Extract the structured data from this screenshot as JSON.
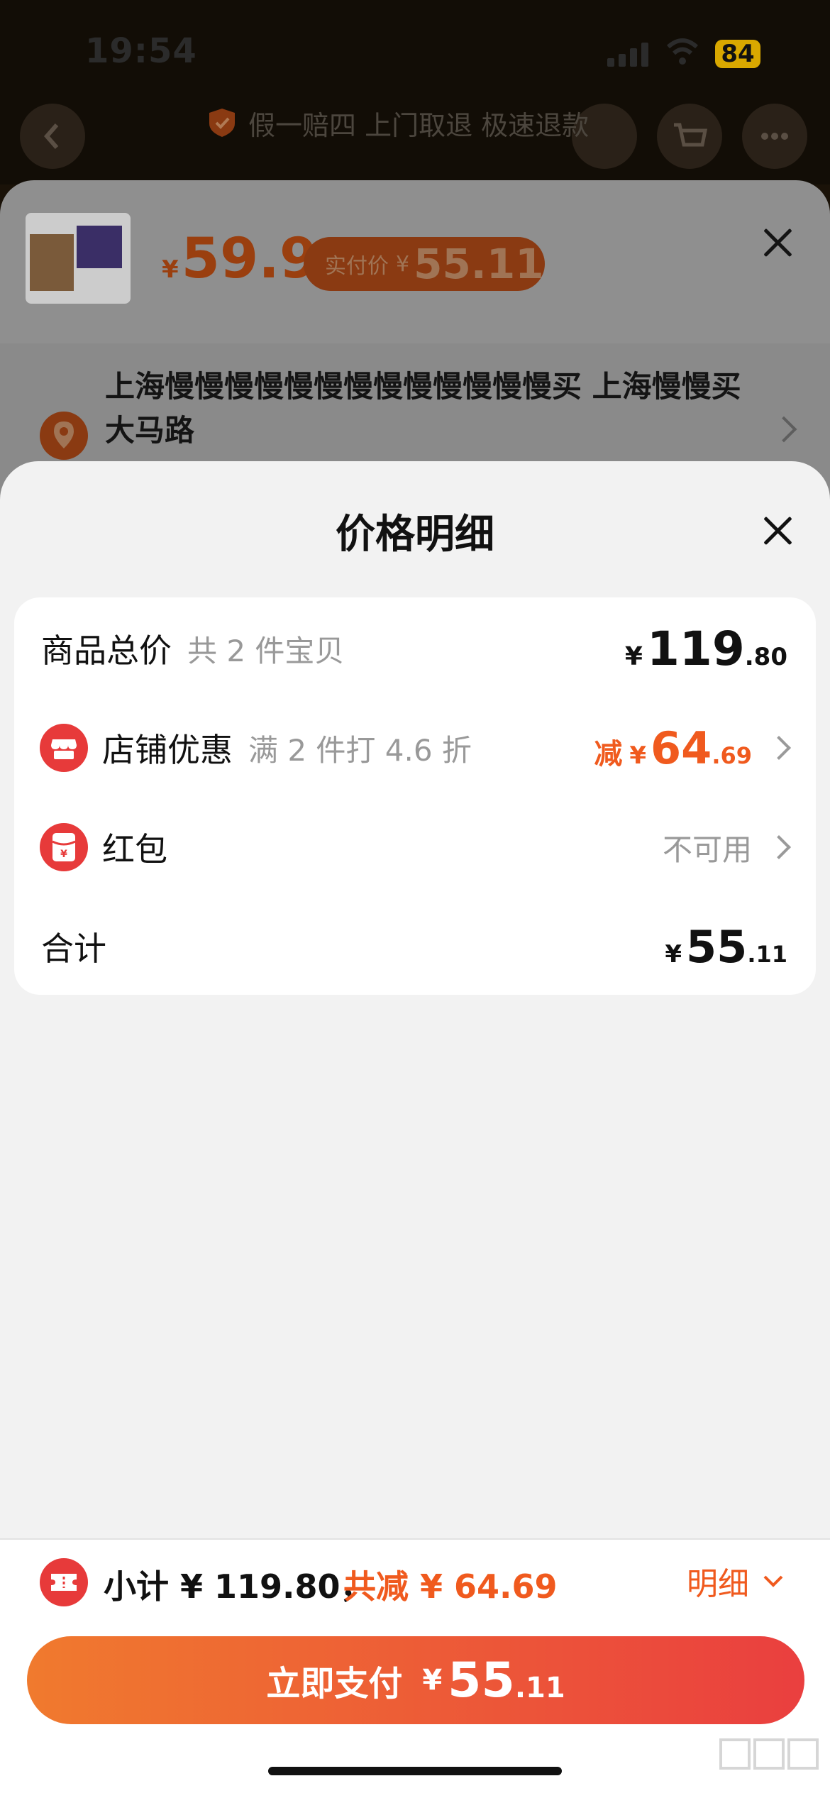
{
  "status_bar": {
    "time": "19:54",
    "battery": "84"
  },
  "nav": {
    "guarantee": "假一赔四 上门取退 极速退款"
  },
  "product_sheet": {
    "currency": "¥",
    "price": "59.9",
    "pay_label": "实付价",
    "pay_amount": "55.11",
    "address": "上海慢慢慢慢慢慢慢慢慢慢慢慢慢买 上海慢慢买大马路"
  },
  "detail": {
    "title": "价格明细",
    "rows": {
      "total": {
        "label": "商品总价",
        "sub": "共 2 件宝贝",
        "currency": "¥",
        "int": "119",
        "dec": ".80"
      },
      "shop": {
        "label": "店铺优惠",
        "sub": "满 2 件打 4.6 折",
        "prefix": "减",
        "currency": "¥",
        "int": "64",
        "dec": ".69"
      },
      "redpacket": {
        "label": "红包",
        "value": "不可用"
      },
      "sum": {
        "label": "合计",
        "currency": "¥",
        "int": "55",
        "dec": ".11"
      }
    }
  },
  "bottom": {
    "subtotal": "小计 ¥ 119.80，",
    "discount": "共减 ¥ 64.69",
    "detail_link": "明细",
    "pay_button_label": "立即支付",
    "pay_currency": "¥",
    "pay_int": "55",
    "pay_dec": ".11"
  },
  "colors": {
    "accent": "#f05a1e",
    "red": "#e73a3a"
  }
}
